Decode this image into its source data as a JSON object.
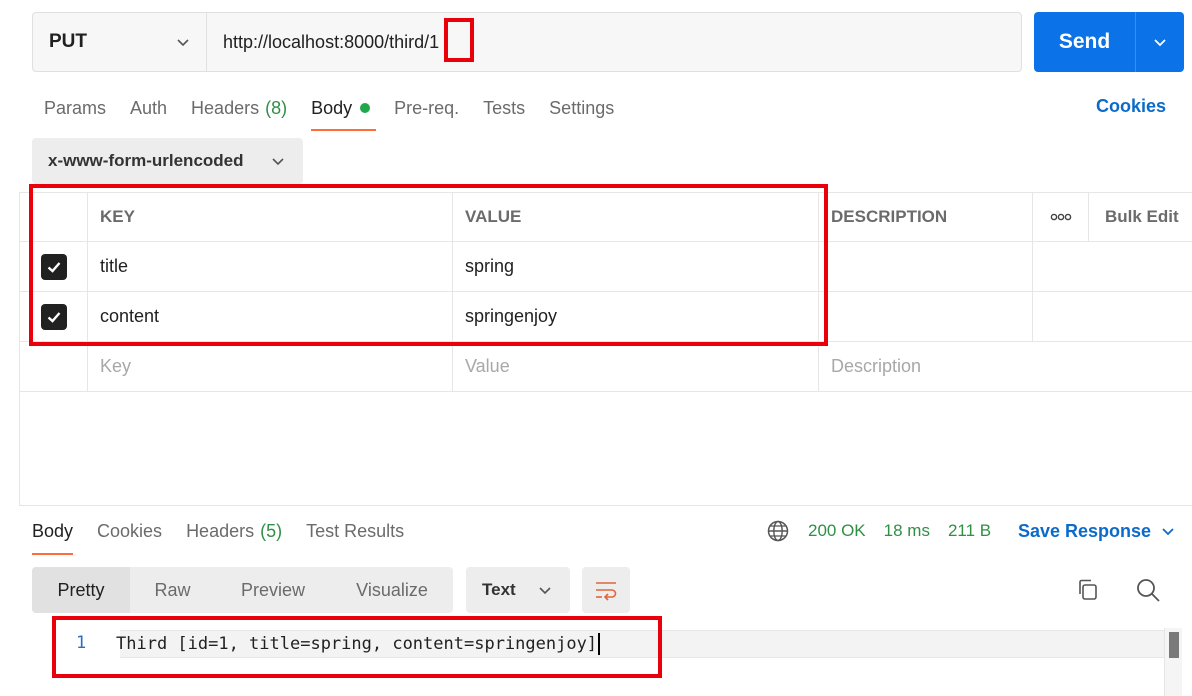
{
  "request": {
    "method": "PUT",
    "url_prefix": "http://localhost:8000/third/",
    "url_id": "1",
    "send_label": "Send"
  },
  "request_tabs": [
    {
      "label": "Params"
    },
    {
      "label": "Auth"
    },
    {
      "label": "Headers",
      "count": "(8)"
    },
    {
      "label": "Body",
      "active": true
    },
    {
      "label": "Pre-req."
    },
    {
      "label": "Tests"
    },
    {
      "label": "Settings"
    }
  ],
  "cookies_link": "Cookies",
  "body_type": "x-www-form-urlencoded",
  "params_table": {
    "headers": {
      "key": "KEY",
      "value": "VALUE",
      "description": "DESCRIPTION",
      "more": "ooo",
      "bulk_edit": "Bulk Edit"
    },
    "rows": [
      {
        "checked": true,
        "key": "title",
        "value": "spring",
        "description": ""
      },
      {
        "checked": true,
        "key": "content",
        "value": "springenjoy",
        "description": ""
      }
    ],
    "placeholders": {
      "key": "Key",
      "value": "Value",
      "description": "Description"
    }
  },
  "response_tabs": [
    {
      "label": "Body",
      "active": true
    },
    {
      "label": "Cookies"
    },
    {
      "label": "Headers",
      "count": "(5)"
    },
    {
      "label": "Test Results"
    }
  ],
  "response_meta": {
    "status": "200 OK",
    "time": "18 ms",
    "size": "211 B",
    "save_label": "Save Response"
  },
  "view_tabs": [
    "Pretty",
    "Raw",
    "Preview",
    "Visualize"
  ],
  "format": "Text",
  "code": {
    "line_number": "1",
    "text": "Third [id=1, title=spring, content=springenjoy]"
  },
  "colors": {
    "accent": "#ff6c37",
    "send": "#0b72e7",
    "status_ok": "#2f8f46",
    "annotation": "#e8000b"
  },
  "icons": [
    "chevron-down-icon",
    "globe-icon",
    "wrap-icon",
    "copy-icon",
    "search-icon",
    "more-dots-icon",
    "checkbox-checked-icon"
  ]
}
